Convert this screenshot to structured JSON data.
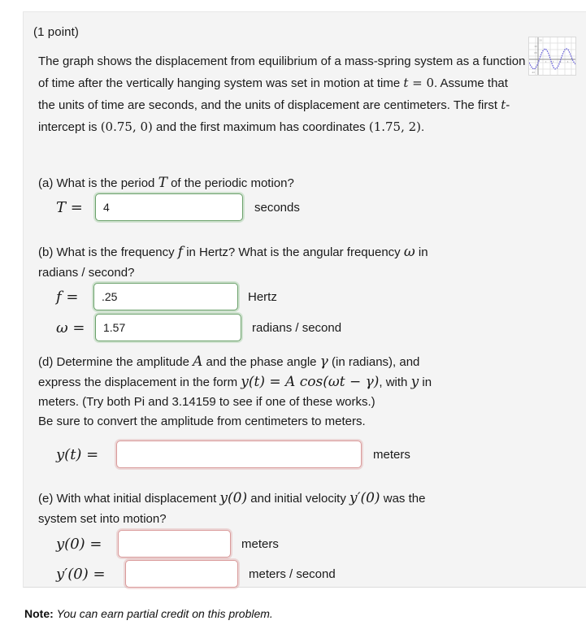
{
  "problem": {
    "points_label": "(1 point)",
    "intro_segments": [
      {
        "t": "The graph shows the displacement from equilibrium of a mass-spring system as a function of time after the vertically hanging system was set in motion at time ",
        "k": "text"
      },
      {
        "t": "t = 0",
        "k": "math"
      },
      {
        "t": ". Assume that the units of time are seconds, and the units of displacement are centimeters. The first ",
        "k": "text"
      },
      {
        "t": "t",
        "k": "math"
      },
      {
        "t": "-intercept is ",
        "k": "text"
      },
      {
        "t": "(0.75, 0)",
        "k": "num"
      },
      {
        "t": " and the first maximum has coordinates ",
        "k": "text"
      },
      {
        "t": "(1.75, 2)",
        "k": "num"
      },
      {
        "t": ".",
        "k": "text"
      }
    ],
    "intro_plain": "The graph shows the displacement from equilibrium of a mass-spring system as a function of time after the vertically hanging system was set in motion at time t = 0. Assume that the units of time are seconds, and the units of displacement are centimeters. The first t-intercept is (0.75, 0) and the first maximum has coordinates (1.75, 2)."
  },
  "thumbnail": {
    "name": "displacement-graph-thumbnail",
    "description": "small sinusoidal displacement vs time plot on grid",
    "curve_color": "#6a63d8",
    "grid_color": "#dcdcdc",
    "axis_color": "#8a8a8a"
  },
  "parts": {
    "a": {
      "prompt_pre": "(a) What is the period ",
      "prompt_var": "T",
      "prompt_post": " of the periodic motion?",
      "prompt_plain": "(a) What is the period T of the periodic motion?",
      "lhs": "T =",
      "value": "4",
      "placeholder": "",
      "unit": "seconds",
      "state": "ok"
    },
    "b": {
      "prompt_line1_pre": "(b) What is the frequency ",
      "prompt_line1_var": "f",
      "prompt_line1_mid": " in Hertz? What is the angular frequency ",
      "prompt_line1_var2": "ω",
      "prompt_line1_post": " in",
      "prompt_line2": "radians / second?",
      "prompt_plain": "(b) What is the frequency f in Hertz? What is the angular frequency ω in radians / second?",
      "f": {
        "lhs": "f =",
        "value": ".25",
        "placeholder": "",
        "unit": "Hertz",
        "state": "ok"
      },
      "omega": {
        "lhs": "ω =",
        "value": "1.57",
        "placeholder": "",
        "unit": "radians / second",
        "state": "ok"
      }
    },
    "d": {
      "prompt_plain": "(d) Determine the amplitude A and the phase angle γ (in radians), and express the displacement in the form y(t) = A cos(ωt − γ), with y in meters. (Try both Pi and 3.14159 to see if one of these works.)",
      "line1_pre": "(d) Determine the amplitude ",
      "line1_varA": "A",
      "line1_mid": " and the phase angle ",
      "line1_varG": "γ",
      "line1_post": " (in radians), and",
      "line2_pre": "express the displacement in the form ",
      "line2_formula": "y(t) = A cos(ωt − γ)",
      "line2_mid": ", with ",
      "line2_vary": "y",
      "line2_post": " in",
      "line3": "meters. (Try both Pi and 3.14159 to see if one of these works.)",
      "line4": "Be sure to convert the amplitude from centimeters to meters.",
      "lhs": "y(t) =",
      "value": "",
      "placeholder": "",
      "unit": "meters",
      "state": "bad"
    },
    "e": {
      "prompt_plain": "(e) With what initial displacement y(0) and initial velocity y'(0) was the system set into motion?",
      "line1_pre": "(e) With what initial displacement ",
      "line1_y0": "y(0)",
      "line1_mid": " and initial velocity ",
      "line1_yp0": "y′(0)",
      "line1_post": " was the",
      "line2": "system set into motion?",
      "y0": {
        "lhs": "y(0) =",
        "value": "",
        "placeholder": "",
        "unit": "meters",
        "state": "bad"
      },
      "yprime0": {
        "lhs": "y′(0) =",
        "value": "",
        "placeholder": "",
        "unit": "meters / second",
        "state": "bad"
      }
    }
  },
  "footer": {
    "note_label": "Note:",
    "note_text": "You can earn partial credit on this problem."
  },
  "colors": {
    "panel_bg": "#f4f4f4",
    "page_bg": "#ffffff",
    "correct_border": "#6aa06a",
    "incorrect_border": "#d99a9a",
    "text": "#1a1a1a"
  }
}
